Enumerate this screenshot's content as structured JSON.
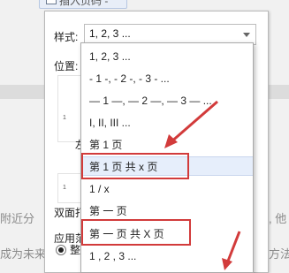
{
  "toolbar": {
    "insert_page_number_label": "插入页码 -"
  },
  "dialog": {
    "style_label": "样式:",
    "style_value": "1, 2, 3 ...",
    "position_label": "位置:",
    "preview_number": "1",
    "preview2_number": "1",
    "left_label_cut": "左",
    "dual_label_cut": "双面打",
    "apply_label_cut": "应用范",
    "whole_label_cut": "整篇"
  },
  "dropdown": {
    "items": [
      "1, 2, 3 ...",
      "- 1 -, - 2 -, - 3 - ...",
      "— 1 —, — 2 —, — 3 — ...",
      "I, II, III ...",
      "第 1 页",
      "第 1 页 共 x 页",
      "1 / x",
      "第 一 页",
      "第 一 页 共 X 页",
      "1 , 2 , 3 ..."
    ],
    "selected_index": 5
  },
  "document": {
    "line1_left": "附近分",
    "line1_right": "集, 他",
    "line2_left": "成为未来",
    "line2_right": "的方法"
  },
  "colors": {
    "highlight": "#d23b3b",
    "selection": "#e6eefb"
  }
}
